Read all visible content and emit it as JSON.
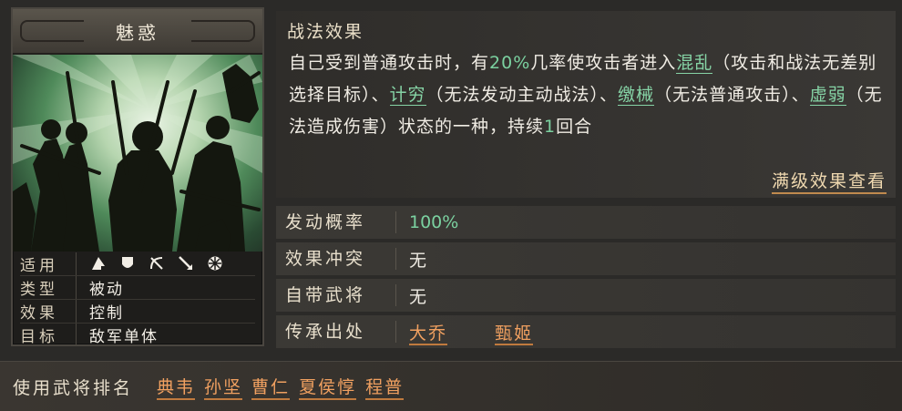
{
  "skill": {
    "name": "魅惑",
    "info": [
      {
        "key": "适用",
        "value": ""
      },
      {
        "key": "类型",
        "value": "被动"
      },
      {
        "key": "效果",
        "value": "控制"
      },
      {
        "key": "目标",
        "value": "敌军单体"
      }
    ],
    "troop_icons": [
      "cavalry-icon",
      "shield-icon",
      "bow-icon",
      "spear-icon",
      "wheel-icon"
    ]
  },
  "effect": {
    "heading": "战法效果",
    "text": {
      "p1": "自己受到普通攻击时，有",
      "chance": "20%",
      "p2": "几率使攻击者进入",
      "s1": "混乱",
      "p3": "（攻击和战法无差别选择目标）、",
      "s2": "计穷",
      "p4": "（无法发动主动战法）、",
      "s3": "缴械",
      "p5": "（无法普通攻击）、",
      "s4": "虚弱",
      "p6": "（无法造成伤害）状态的一种，持续",
      "turns": "1",
      "p7": "回合"
    },
    "full_button": "满级效果查看"
  },
  "stats": [
    {
      "key": "发动概率",
      "value": "100%"
    },
    {
      "key": "效果冲突",
      "value": "无"
    },
    {
      "key": "自带武将",
      "value": "无"
    }
  ],
  "inherit": {
    "key": "传承出处",
    "sources": [
      "大乔",
      "甄姬"
    ]
  },
  "users": {
    "label": "使用武将排名",
    "generals": [
      "典韦",
      "孙坚",
      "曹仁",
      "夏侯惇",
      "程普"
    ]
  },
  "colors": {
    "highlight_green": "#7bd1a0",
    "link_orange": "#f0a060",
    "background": "#2b2a28"
  }
}
